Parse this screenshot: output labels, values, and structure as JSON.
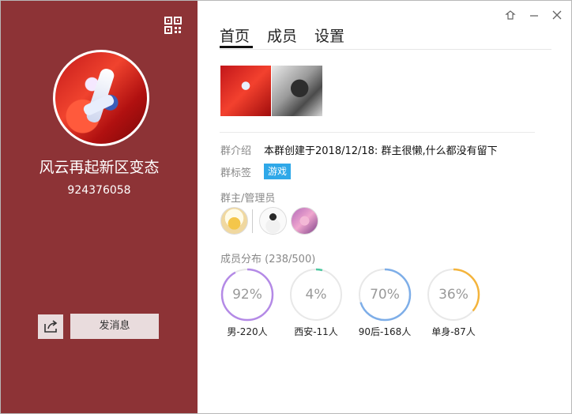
{
  "group": {
    "name": "风云再起新区变态",
    "id": "924376058",
    "send_label": "发消息"
  },
  "icons": {
    "qr": "qr-code-icon",
    "share": "share-icon",
    "skin": "skin-icon",
    "minimize": "minimize-icon",
    "close": "close-icon"
  },
  "tabs": [
    "首页",
    "成员",
    "设置"
  ],
  "info": {
    "intro_label": "群介绍",
    "intro_value": "本群创建于2018/12/18:  群主很懒,什么都没有留下",
    "tag_label": "群标签",
    "tag_value": "游戏",
    "admins_label": "群主/管理员",
    "members_label": "成员分布 (238/500)"
  },
  "stats": [
    {
      "percent": 92,
      "text": "92%",
      "label": "男-220人",
      "color": "#b48ae6"
    },
    {
      "percent": 4,
      "text": "4%",
      "label": "西安-11人",
      "color": "#4cc8a0"
    },
    {
      "percent": 70,
      "text": "70%",
      "label": "90后-168人",
      "color": "#7eaee8"
    },
    {
      "percent": 36,
      "text": "36%",
      "label": "单身-87人",
      "color": "#f4b43c"
    }
  ],
  "colors": {
    "sidebar_bg": "#8d3336",
    "button_bg": "#e9dcdd",
    "tag_bg": "#2fa8e8"
  }
}
